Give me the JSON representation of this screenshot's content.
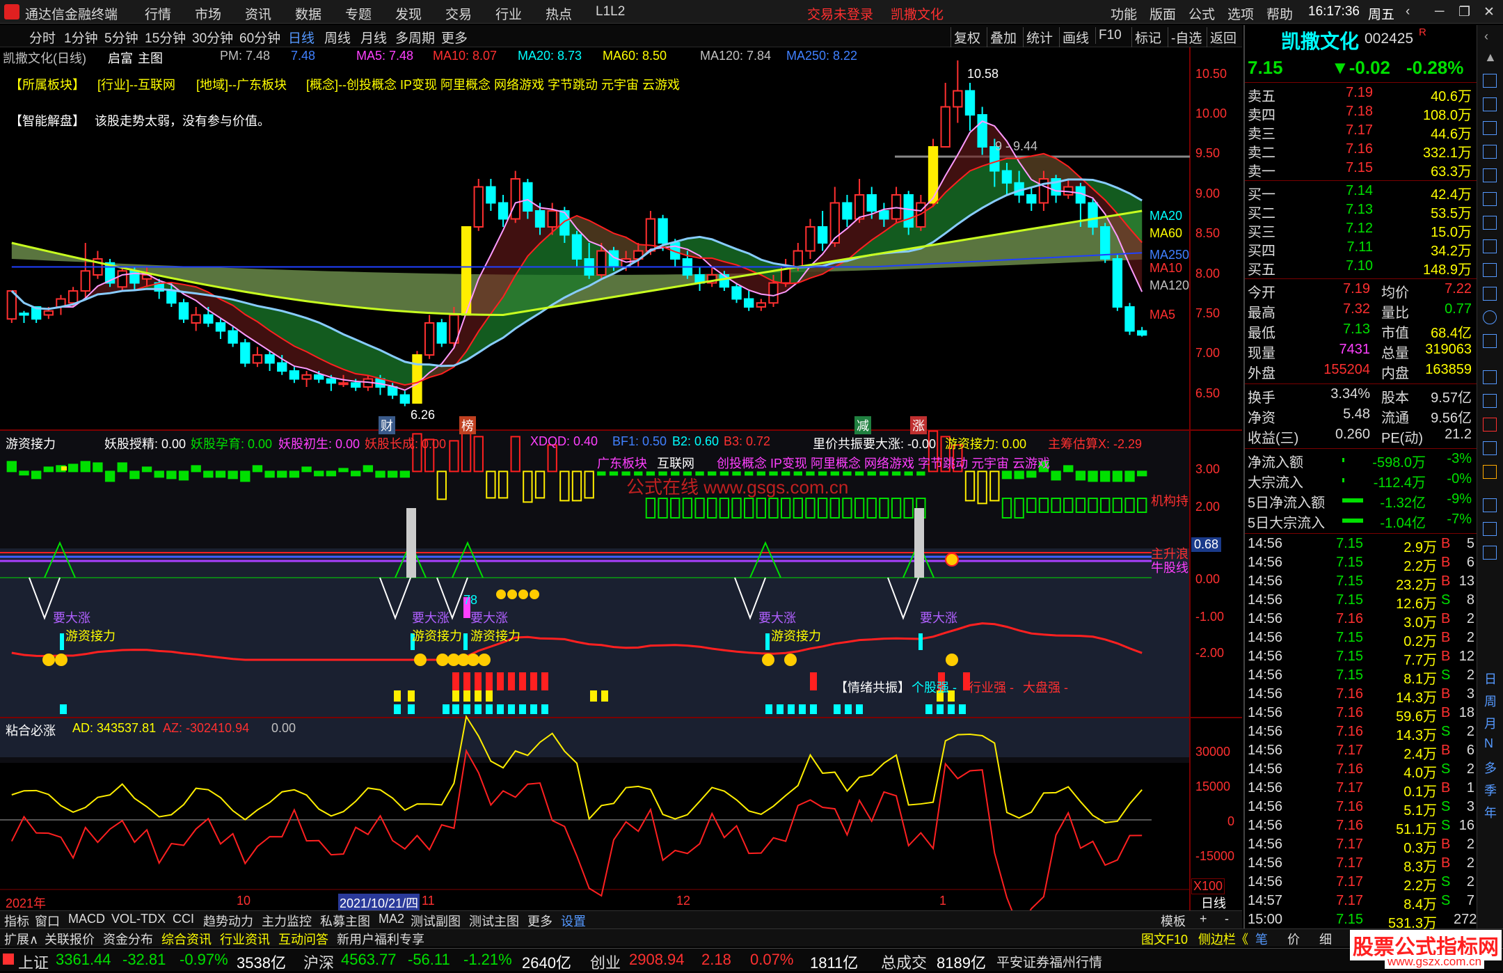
{
  "app": {
    "title": "通达信金融终端",
    "login": "交易未登录",
    "stock_head": "凯撒文化",
    "clock": "16:17:36",
    "weekday": "周五"
  },
  "menu": [
    "行情",
    "市场",
    "资讯",
    "数据",
    "专题",
    "发现",
    "交易",
    "行业",
    "热点",
    "L1L2"
  ],
  "sysmenu": [
    "功能",
    "版面",
    "公式",
    "选项",
    "帮助"
  ],
  "timeframes": [
    "分时",
    "1分钟",
    "5分钟",
    "15分钟",
    "30分钟",
    "60分钟",
    "日线",
    "周线",
    "月线",
    "多周期",
    "更多"
  ],
  "active_tf": "日线",
  "tools": [
    "复权",
    "叠加",
    "统计",
    "画线",
    "F10",
    "标记",
    "-自选",
    "返回"
  ],
  "main": {
    "name": "凯撒文化(日线)",
    "chip": "启富",
    "chip2": "主图",
    "pm": "PM: 7.48",
    "pm2": "7.48",
    "ma": [
      "MA5: 7.48",
      "MA10: 8.07",
      "MA20: 8.73",
      "MA60: 8.50",
      "MA120: 7.84",
      "MA250: 8.22"
    ],
    "sector_tags": [
      "【所属板块】",
      "[行业]--互联网",
      "[地域]--广东板块",
      "[概念]--创投概念 IP变现 阿里概念 网络游戏 字节跳动 元宇宙 云游戏"
    ],
    "smart_label": "【智能解盘】",
    "smart_text": "该股走势太弱，没有参与价值。",
    "high_note": "10.58",
    "low_note": "6.26",
    "level_note": "9 - 9.44",
    "axis": [
      "10.50",
      "10.00",
      "9.50",
      "9.00",
      "8.50",
      "8.00",
      "7.50",
      "7.00",
      "6.50"
    ],
    "ma_labels": [
      "MA20",
      "MA60",
      "MA250",
      "MA10",
      "MA120",
      "MA5"
    ],
    "markers": [
      "财",
      "榜",
      "减",
      "涨"
    ]
  },
  "sub1": {
    "name": "游资接力",
    "items": [
      "妖股授精: 0.00",
      "妖股孕育: 0.00",
      "妖股初生: 0.00",
      "妖股长成: 0.00",
      "XDQD: 0.40",
      "BF1: 0.50",
      "B2: 0.60",
      "B3: 0.72",
      "里价共振要大涨: -0.00",
      "游资接力: 0.00",
      "主筹估算X: -2.29"
    ],
    "tags": [
      "广东板块",
      "互联网",
      "创投概念 IP变现 阿里概念 网络游戏 字节跳动 元宇宙 云游戏"
    ],
    "watermark": "公式在线 www.gsgs.com.cn",
    "axis": [
      "3.00",
      "2.00",
      "0.68",
      "0.00",
      "-1.00",
      "-2.00"
    ],
    "line_labels": [
      "机构持",
      "主升浪",
      "牛股线"
    ],
    "signals": [
      "要大涨",
      "游资接力"
    ],
    "num": "78",
    "emo_text": [
      "【情绪共振】",
      "个股强 -",
      "行业强 -",
      "大盘强 -"
    ]
  },
  "sub2": {
    "name": "粘合必涨",
    "items": [
      "AD: 343537.81",
      "AZ: -302410.94",
      "0.00"
    ],
    "axis": [
      "30000",
      "15000",
      "0",
      "-15000"
    ],
    "scale": "X100"
  },
  "dates": [
    "2021年",
    "10",
    "2021/10/21/四",
    "11",
    "12",
    "1"
  ],
  "right": {
    "name": "凯撒文化",
    "code": "002425",
    "flag": "R",
    "price": "7.15",
    "chg": "▼-0.02",
    "pct": "-0.28%",
    "asks": [
      [
        "卖五",
        "7.19",
        "40.6万"
      ],
      [
        "卖四",
        "7.18",
        "108.0万"
      ],
      [
        "卖三",
        "7.17",
        "44.6万"
      ],
      [
        "卖二",
        "7.16",
        "332.1万"
      ],
      [
        "卖一",
        "7.15",
        "63.3万"
      ]
    ],
    "bids": [
      [
        "买一",
        "7.14",
        "42.4万"
      ],
      [
        "买二",
        "7.13",
        "53.5万"
      ],
      [
        "买三",
        "7.12",
        "15.0万"
      ],
      [
        "买四",
        "7.11",
        "34.2万"
      ],
      [
        "买五",
        "7.10",
        "148.9万"
      ]
    ],
    "stats": [
      [
        "今开",
        "7.19",
        "均价",
        "7.22"
      ],
      [
        "最高",
        "7.32",
        "量比",
        "0.77"
      ],
      [
        "最低",
        "7.13",
        "市值",
        "68.4亿"
      ],
      [
        "现量",
        "7431",
        "总量",
        "319063"
      ],
      [
        "外盘",
        "155204",
        "内盘",
        "163859"
      ]
    ],
    "stats2": [
      [
        "换手",
        "3.34%",
        "股本",
        "9.57亿"
      ],
      [
        "净资",
        "5.48",
        "流通",
        "9.56亿"
      ],
      [
        "收益(三)",
        "0.260",
        "PE(动)",
        "21.2"
      ]
    ],
    "flows": [
      [
        "净流入额",
        "-598.0万",
        "-3%"
      ],
      [
        "大宗流入",
        "-112.4万",
        "-0%"
      ],
      [
        "5日净流入额",
        "-1.32亿",
        "-9%"
      ],
      [
        "5日大宗流入",
        "-1.04亿",
        "-7%"
      ]
    ],
    "ticks": [
      [
        "14:56",
        "7.15",
        "2.9万",
        "B",
        "5"
      ],
      [
        "14:56",
        "7.15",
        "2.2万",
        "B",
        "6"
      ],
      [
        "14:56",
        "7.15",
        "23.2万",
        "B",
        "13"
      ],
      [
        "14:56",
        "7.15",
        "12.6万",
        "S",
        "8"
      ],
      [
        "14:56",
        "7.16",
        "3.0万",
        "B",
        "2"
      ],
      [
        "14:56",
        "7.15",
        "0.2万",
        "B",
        "2"
      ],
      [
        "14:56",
        "7.15",
        "7.7万",
        "B",
        "12"
      ],
      [
        "14:56",
        "7.15",
        "8.1万",
        "S",
        "2"
      ],
      [
        "14:56",
        "7.16",
        "14.3万",
        "B",
        "3"
      ],
      [
        "14:56",
        "7.16",
        "59.6万",
        "B",
        "18"
      ],
      [
        "14:56",
        "7.16",
        "14.3万",
        "S",
        "2"
      ],
      [
        "14:56",
        "7.17",
        "2.4万",
        "B",
        "6"
      ],
      [
        "14:56",
        "7.16",
        "4.0万",
        "S",
        "2"
      ],
      [
        "14:56",
        "7.17",
        "0.1万",
        "B",
        "1"
      ],
      [
        "14:56",
        "7.16",
        "5.1万",
        "S",
        "3"
      ],
      [
        "14:56",
        "7.16",
        "51.1万",
        "S",
        "16"
      ],
      [
        "14:56",
        "7.17",
        "0.3万",
        "B",
        "2"
      ],
      [
        "14:56",
        "7.17",
        "8.3万",
        "B",
        "2"
      ],
      [
        "14:56",
        "7.17",
        "2.2万",
        "S",
        "2"
      ],
      [
        "14:57",
        "7.17",
        "8.4万",
        "S",
        "7"
      ],
      [
        "15:00",
        "7.15",
        "531.3万",
        "",
        "272"
      ]
    ],
    "side": [
      "日",
      "周",
      "月",
      "N",
      "多",
      "季",
      "年"
    ]
  },
  "bottom_tabs": [
    "指标",
    "窗口",
    "MACD",
    "VOL-TDX",
    "CCI",
    "趋势动力",
    "主力监控",
    "私募主图",
    "MA2",
    "测试副图",
    "测试主图",
    "更多",
    "设置"
  ],
  "bottom_tabs2": [
    "扩展∧",
    "关联报价",
    "资金分布",
    "综合资讯",
    "行业资讯",
    "互动问答",
    "新用户福利专享"
  ],
  "bottom_right": [
    "模板",
    "+",
    "-",
    "图文F10",
    "侧边栏《",
    "笔",
    "价",
    "细"
  ],
  "status": [
    [
      "上证",
      "3361.44",
      "-32.81",
      "-0.97%",
      "3538亿"
    ],
    [
      "沪深",
      "4563.77",
      "-56.11",
      "-1.21%",
      "2640亿"
    ],
    [
      "创业",
      "2908.94",
      "2.18",
      "0.07%",
      "1811亿"
    ]
  ],
  "total": [
    "总成交",
    "8189亿"
  ],
  "broker": "平安证券福州行情",
  "logo": "股票公式指标网",
  "logo_url": "www.gszx.com.cn",
  "candles": [
    [
      7.35,
      7.7,
      7.7,
      7.3
    ],
    [
      7.42,
      7.4,
      7.45,
      7.3
    ],
    [
      7.5,
      7.35,
      7.5,
      7.3
    ],
    [
      7.4,
      7.45,
      7.5,
      7.35
    ],
    [
      7.5,
      7.6,
      7.65,
      7.4
    ],
    [
      7.55,
      7.7,
      7.75,
      7.5
    ],
    [
      7.7,
      7.95,
      8.3,
      7.6
    ],
    [
      7.9,
      8.1,
      8.2,
      7.85
    ],
    [
      8.05,
      7.8,
      8.1,
      7.75
    ],
    [
      7.75,
      7.95,
      8.0,
      7.7
    ],
    [
      7.95,
      7.8,
      8.0,
      7.7
    ],
    [
      7.85,
      7.9,
      8.0,
      7.75
    ],
    [
      7.8,
      7.7,
      7.85,
      7.6
    ],
    [
      7.7,
      7.55,
      7.8,
      7.5
    ],
    [
      7.55,
      7.35,
      7.6,
      7.3
    ],
    [
      7.3,
      7.4,
      7.5,
      7.2
    ],
    [
      7.4,
      7.3,
      7.5,
      7.25
    ],
    [
      7.3,
      7.2,
      7.35,
      7.1
    ],
    [
      7.2,
      7.05,
      7.25,
      7.0
    ],
    [
      7.05,
      6.8,
      7.1,
      6.75
    ],
    [
      6.8,
      6.9,
      7.0,
      6.75
    ],
    [
      6.9,
      6.8,
      6.95,
      6.7
    ],
    [
      6.8,
      6.7,
      6.9,
      6.65
    ],
    [
      6.7,
      6.6,
      6.75,
      6.55
    ],
    [
      6.6,
      6.65,
      6.7,
      6.5
    ],
    [
      6.65,
      6.6,
      6.7,
      6.55
    ],
    [
      6.6,
      6.55,
      6.65,
      6.45
    ],
    [
      6.55,
      6.55,
      6.65,
      6.5
    ],
    [
      6.55,
      6.5,
      6.6,
      6.45
    ],
    [
      6.5,
      6.6,
      6.65,
      6.45
    ],
    [
      6.6,
      6.5,
      6.65,
      6.4
    ],
    [
      6.5,
      6.4,
      6.55,
      6.35
    ],
    [
      6.4,
      6.3,
      6.45,
      6.26
    ],
    [
      6.3,
      6.9,
      6.95,
      6.3
    ],
    [
      6.9,
      7.3,
      7.4,
      6.85
    ],
    [
      7.3,
      7.05,
      7.35,
      7.0
    ],
    [
      7.05,
      7.4,
      7.5,
      7.0
    ],
    [
      7.4,
      8.5,
      8.5,
      7.4
    ],
    [
      8.5,
      9.0,
      9.1,
      8.45
    ],
    [
      9.0,
      8.8,
      9.1,
      8.7
    ],
    [
      8.8,
      8.6,
      8.9,
      8.5
    ],
    [
      8.6,
      9.1,
      9.2,
      8.55
    ],
    [
      9.05,
      8.7,
      9.1,
      8.6
    ],
    [
      8.7,
      8.5,
      8.8,
      8.4
    ],
    [
      8.5,
      8.7,
      8.8,
      8.4
    ],
    [
      8.7,
      8.4,
      8.75,
      8.3
    ],
    [
      8.4,
      8.1,
      8.45,
      8.0
    ],
    [
      8.1,
      7.9,
      8.3,
      7.85
    ],
    [
      7.9,
      8.2,
      8.3,
      7.85
    ],
    [
      8.2,
      8.0,
      8.25,
      7.95
    ],
    [
      8.0,
      8.1,
      8.2,
      7.95
    ],
    [
      8.1,
      8.2,
      8.3,
      8.0
    ],
    [
      8.2,
      8.6,
      8.7,
      8.15
    ],
    [
      8.6,
      8.3,
      8.65,
      8.2
    ],
    [
      8.3,
      8.1,
      8.35,
      8.0
    ],
    [
      8.1,
      7.9,
      8.2,
      7.85
    ],
    [
      7.9,
      7.8,
      8.0,
      7.7
    ],
    [
      7.8,
      7.9,
      8.0,
      7.75
    ],
    [
      7.9,
      7.75,
      7.95,
      7.7
    ],
    [
      7.75,
      7.6,
      7.8,
      7.55
    ],
    [
      7.6,
      7.5,
      7.7,
      7.45
    ],
    [
      7.5,
      7.55,
      7.6,
      7.45
    ],
    [
      7.55,
      7.8,
      7.9,
      7.5
    ],
    [
      7.8,
      8.0,
      8.1,
      7.75
    ],
    [
      8.0,
      8.2,
      8.3,
      7.95
    ],
    [
      8.2,
      8.5,
      8.6,
      8.1
    ],
    [
      8.5,
      8.3,
      8.7,
      8.2
    ],
    [
      8.3,
      8.8,
      9.0,
      8.25
    ],
    [
      8.8,
      8.6,
      8.9,
      8.5
    ],
    [
      8.6,
      8.9,
      9.1,
      8.55
    ],
    [
      8.9,
      8.7,
      9.0,
      8.6
    ],
    [
      8.7,
      8.6,
      8.8,
      8.5
    ],
    [
      8.6,
      8.9,
      9.0,
      8.55
    ],
    [
      8.9,
      8.5,
      8.95,
      8.4
    ],
    [
      8.5,
      8.8,
      8.9,
      8.45
    ],
    [
      8.8,
      9.5,
      9.6,
      8.75
    ],
    [
      9.5,
      10.0,
      10.3,
      9.5
    ],
    [
      10.0,
      10.2,
      10.58,
      9.8
    ],
    [
      10.2,
      9.9,
      10.3,
      9.7
    ],
    [
      9.9,
      9.5,
      10.0,
      9.4
    ],
    [
      9.5,
      9.2,
      9.6,
      9.0
    ],
    [
      9.2,
      9.05,
      9.3,
      8.9
    ],
    [
      9.05,
      8.9,
      9.2,
      8.8
    ],
    [
      8.9,
      8.8,
      9.0,
      8.7
    ],
    [
      8.8,
      9.1,
      9.2,
      8.7
    ],
    [
      9.1,
      8.9,
      9.15,
      8.8
    ],
    [
      8.9,
      9.0,
      9.1,
      8.85
    ],
    [
      9.0,
      8.8,
      9.05,
      8.5
    ],
    [
      8.8,
      8.5,
      8.85,
      8.4
    ],
    [
      8.5,
      8.1,
      8.55,
      8.05
    ],
    [
      8.1,
      7.5,
      8.15,
      7.45
    ],
    [
      7.5,
      7.2,
      7.55,
      7.15
    ],
    [
      7.2,
      7.15,
      7.25,
      7.13
    ]
  ]
}
